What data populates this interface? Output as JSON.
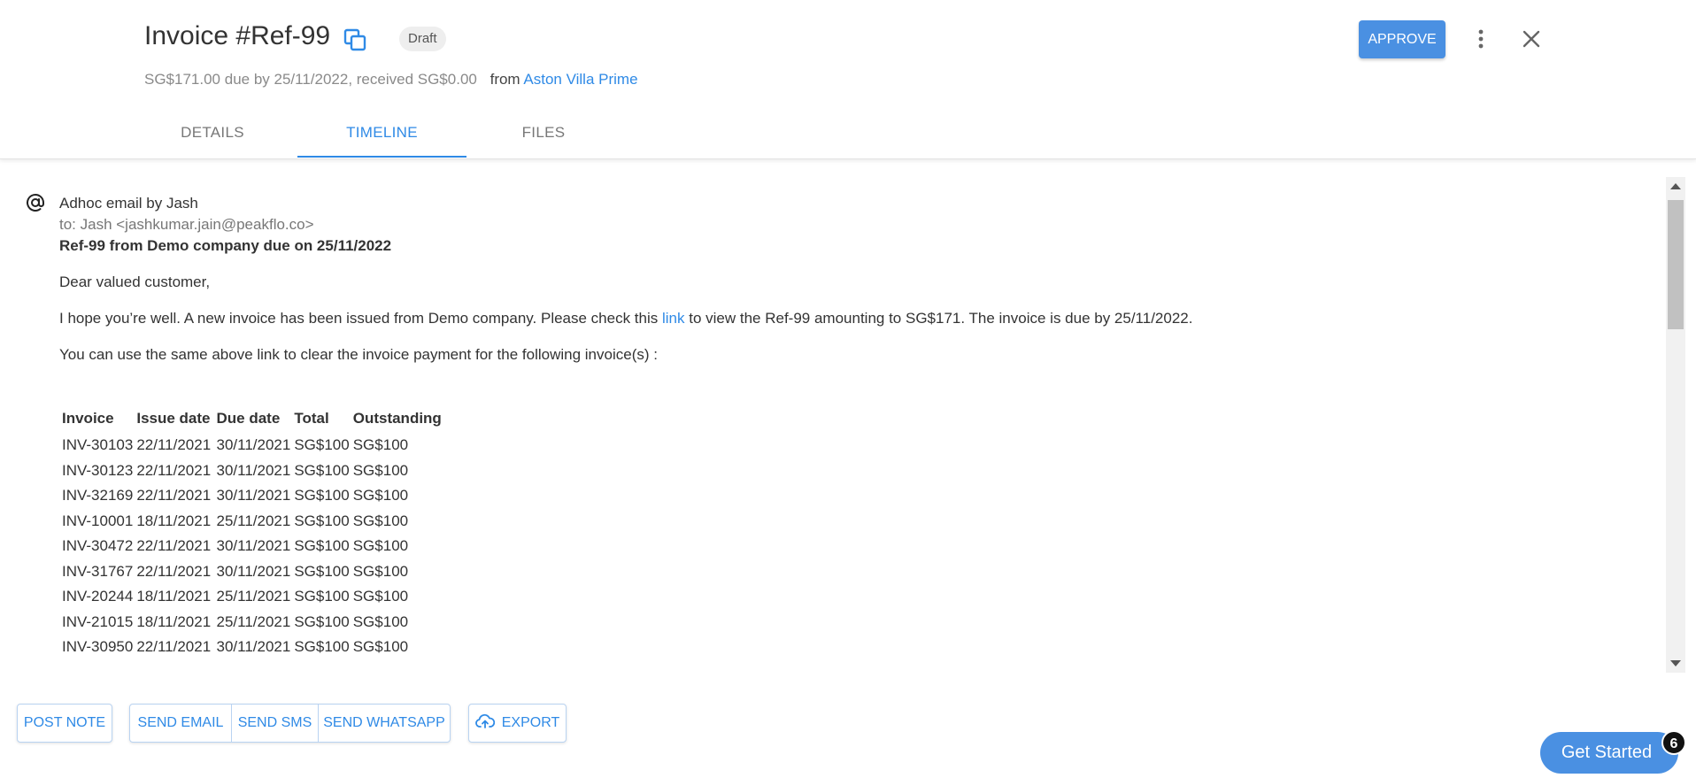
{
  "header": {
    "title": "Invoice #Ref-99",
    "status_badge": "Draft",
    "summary": "SG$171.00 due by 25/11/2022, received SG$0.00",
    "from_label": "from",
    "vendor": "Aston Villa Prime",
    "approve_label": "APPROVE",
    "copy_icon": "copy-icon",
    "more_icon": "more-vertical-icon",
    "close_icon": "close-icon"
  },
  "tabs": [
    {
      "label": "DETAILS",
      "active": false
    },
    {
      "label": "TIMELINE",
      "active": true
    },
    {
      "label": "FILES",
      "active": false
    }
  ],
  "timeline": {
    "entry_icon": "at-sign-icon",
    "title": "Adhoc email by Jash",
    "to": "to: Jash <jashkumar.jain@peakflo.co>",
    "subject": "Ref-99 from Demo company due on 25/11/2022",
    "greeting": "Dear valued customer,",
    "body_before_link": "I hope you’re well. A new invoice has been issued from Demo company. Please check this ",
    "link_text": "link",
    "body_after_link": " to view the Ref-99 amounting to SG$171. The invoice is due by 25/11/2022.",
    "payment_note": "You can use the same above link to clear the invoice payment for the following invoice(s) :",
    "table": {
      "headers": [
        "Invoice",
        "Issue date",
        "Due date",
        "Total",
        "Outstanding"
      ],
      "rows": [
        [
          "INV-30103",
          "22/11/2021",
          "30/11/2021",
          "SG$100",
          "SG$100"
        ],
        [
          "INV-30123",
          "22/11/2021",
          "30/11/2021",
          "SG$100",
          "SG$100"
        ],
        [
          "INV-32169",
          "22/11/2021",
          "30/11/2021",
          "SG$100",
          "SG$100"
        ],
        [
          "INV-10001",
          "18/11/2021",
          "25/11/2021",
          "SG$100",
          "SG$100"
        ],
        [
          "INV-30472",
          "22/11/2021",
          "30/11/2021",
          "SG$100",
          "SG$100"
        ],
        [
          "INV-31767",
          "22/11/2021",
          "30/11/2021",
          "SG$100",
          "SG$100"
        ],
        [
          "INV-20244",
          "18/11/2021",
          "25/11/2021",
          "SG$100",
          "SG$100"
        ],
        [
          "INV-21015",
          "18/11/2021",
          "25/11/2021",
          "SG$100",
          "SG$100"
        ],
        [
          "INV-30950",
          "22/11/2021",
          "30/11/2021",
          "SG$100",
          "SG$100"
        ]
      ]
    }
  },
  "actions": {
    "post_note": "POST NOTE",
    "send_email": "SEND EMAIL",
    "send_sms": "SEND SMS",
    "send_whatsapp": "SEND WHATSAPP",
    "export": "EXPORT",
    "export_icon": "cloud-upload-icon"
  },
  "helper": {
    "get_started": "Get Started",
    "badge_count": "6"
  },
  "colors": {
    "accent": "#2f8ae6",
    "primary_button": "#4a90e2"
  }
}
